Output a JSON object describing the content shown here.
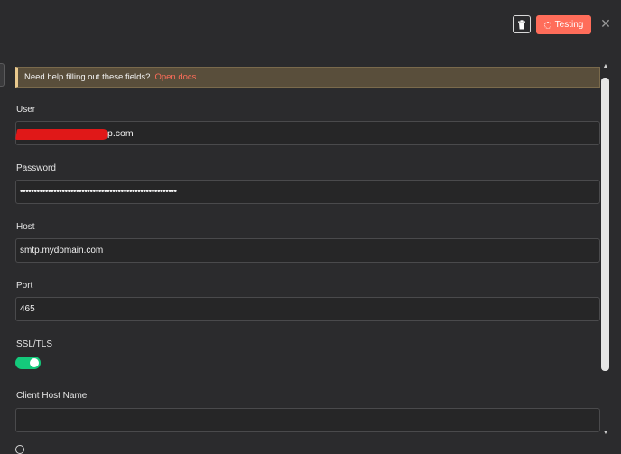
{
  "header": {
    "test_label": "Testing"
  },
  "banner": {
    "text": "Need help filling out these fields?",
    "link": "Open docs"
  },
  "fields": {
    "user": {
      "label": "User",
      "value_visible": "p.com"
    },
    "password": {
      "label": "Password",
      "value": "••••••••••••••••••••••••••••••••••••••••••••••••••••••••"
    },
    "host": {
      "label": "Host",
      "value": "smtp.mydomain.com"
    },
    "port": {
      "label": "Port",
      "value": "465"
    },
    "ssl": {
      "label": "SSL/TLS",
      "enabled": true
    },
    "client_host": {
      "label": "Client Host Name",
      "value": ""
    }
  },
  "colors": {
    "accent": "#ff6d5a",
    "toggle_on": "#14c97b",
    "background": "#2b2b2d"
  }
}
